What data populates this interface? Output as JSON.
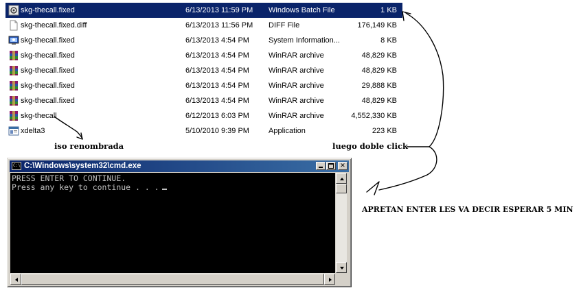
{
  "files": [
    {
      "name": "skg-thecall.fixed",
      "date": "6/13/2013 11:59 PM",
      "type": "Windows Batch File",
      "size": "1 KB",
      "icon": "batch-file-icon",
      "selected": true
    },
    {
      "name": "skg-thecall.fixed.diff",
      "date": "6/13/2013 11:56 PM",
      "type": "DIFF File",
      "size": "176,149 KB",
      "icon": "blank-file-icon",
      "selected": false
    },
    {
      "name": "skg-thecall.fixed",
      "date": "6/13/2013 4:54 PM",
      "type": "System Information...",
      "size": "8 KB",
      "icon": "system-info-icon",
      "selected": false
    },
    {
      "name": "skg-thecall.fixed",
      "date": "6/13/2013 4:54 PM",
      "type": "WinRAR archive",
      "size": "48,829 KB",
      "icon": "winrar-icon",
      "selected": false
    },
    {
      "name": "skg-thecall.fixed",
      "date": "6/13/2013 4:54 PM",
      "type": "WinRAR archive",
      "size": "48,829 KB",
      "icon": "winrar-icon",
      "selected": false
    },
    {
      "name": "skg-thecall.fixed",
      "date": "6/13/2013 4:54 PM",
      "type": "WinRAR archive",
      "size": "29,888 KB",
      "icon": "winrar-icon",
      "selected": false
    },
    {
      "name": "skg-thecall.fixed",
      "date": "6/13/2013 4:54 PM",
      "type": "WinRAR archive",
      "size": "48,829 KB",
      "icon": "winrar-icon",
      "selected": false
    },
    {
      "name": "skg-thecall",
      "date": "6/12/2013 6:03 PM",
      "type": "WinRAR archive",
      "size": "4,552,330 KB",
      "icon": "winrar-icon",
      "selected": false
    },
    {
      "name": "xdelta3",
      "date": "5/10/2010 9:39 PM",
      "type": "Application",
      "size": "223 KB",
      "icon": "application-icon",
      "selected": false
    }
  ],
  "annotations": {
    "iso": "iso renombrada",
    "click": "luego doble click",
    "enter": "APRETAN ENTER LES VA DECIR ESPERAR 5 MIN"
  },
  "cmd": {
    "title": "C:\\Windows\\system32\\cmd.exe",
    "lines": [
      "PRESS ENTER TO CONTINUE.",
      "Press any key to continue . . ."
    ]
  },
  "colors": {
    "selection": "#0a246a",
    "titlebar_start": "#0a246a",
    "titlebar_end": "#3a6ea5",
    "console_bg": "#000000",
    "console_text": "#c0c0c0"
  }
}
